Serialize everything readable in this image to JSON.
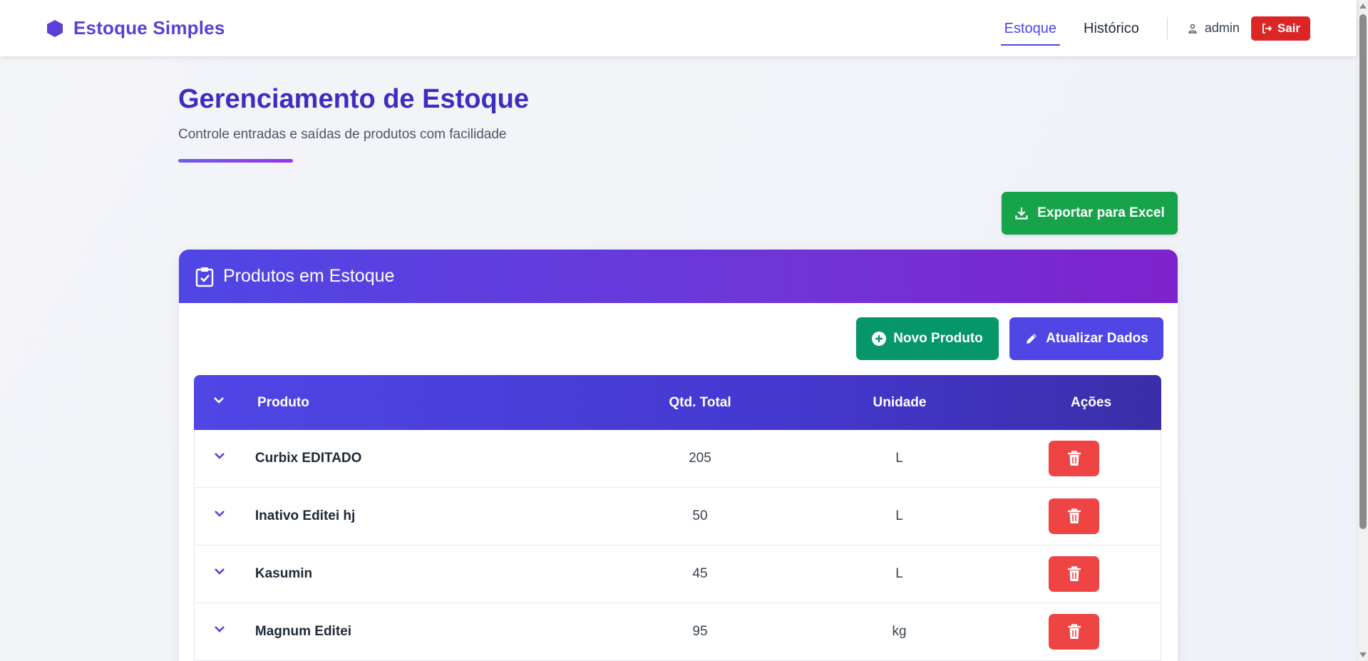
{
  "brand": {
    "name": "Estoque Simples",
    "icon": "hexagon-icon"
  },
  "nav": {
    "links": [
      {
        "label": "Estoque",
        "active": true
      },
      {
        "label": "Histórico",
        "active": false
      }
    ],
    "user": "admin",
    "logout_label": "Sair"
  },
  "header": {
    "title": "Gerenciamento de Estoque",
    "subtitle": "Controle entradas e saídas de produtos com facilidade"
  },
  "export_label": "Exportar para Excel",
  "card": {
    "title": "Produtos em Estoque",
    "new_product_label": "Novo Produto",
    "update_label": "Atualizar Dados"
  },
  "table": {
    "columns": {
      "product": "Produto",
      "qty": "Qtd. Total",
      "unit": "Unidade",
      "actions": "Ações"
    },
    "rows": [
      {
        "product": "Curbix EDITADO",
        "qty": "205",
        "unit": "L"
      },
      {
        "product": "Inativo Editei hj",
        "qty": "50",
        "unit": "L"
      },
      {
        "product": "Kasumin",
        "qty": "45",
        "unit": "L"
      },
      {
        "product": "Magnum Editei",
        "qty": "95",
        "unit": "kg"
      }
    ]
  },
  "colors": {
    "brand": "#5b3fd6",
    "primary": "#4f46e5",
    "success": "#16a34a",
    "danger": "#ef4444",
    "logout": "#dc2626"
  }
}
